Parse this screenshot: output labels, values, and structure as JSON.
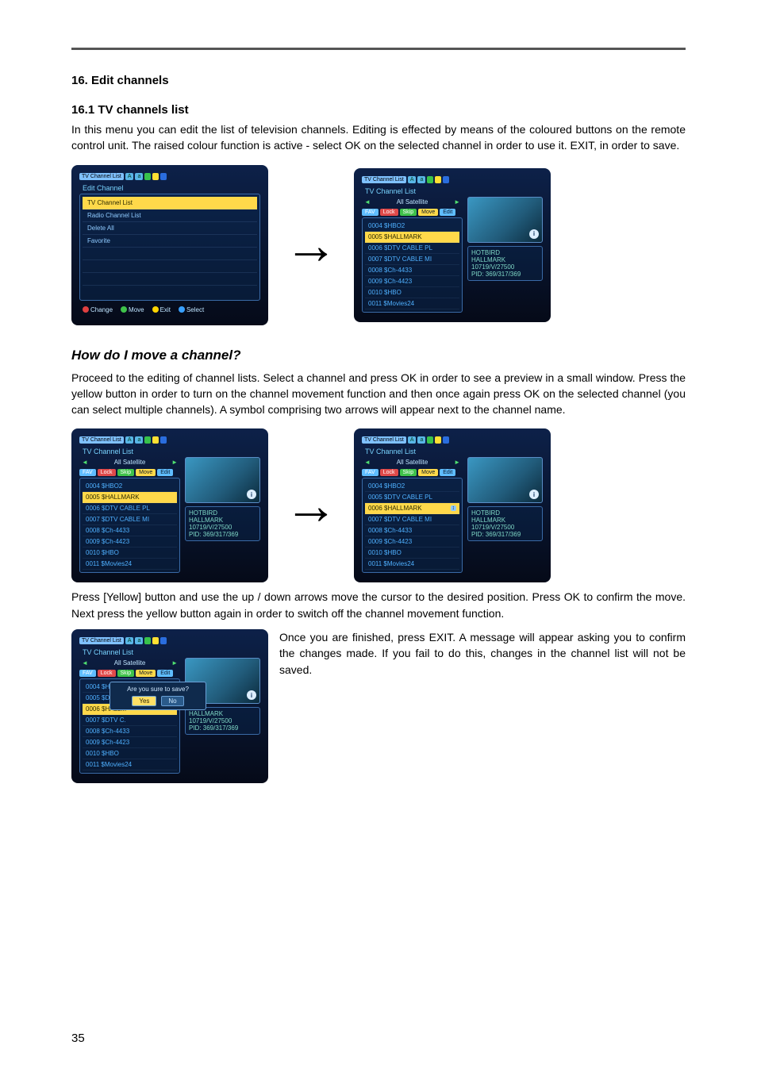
{
  "page_number": "35",
  "section": {
    "num": "16.",
    "title": "Edit channels"
  },
  "subsection": {
    "num": "16.1",
    "title": "TV channels list"
  },
  "intro_para": "In this menu you can edit the list of television channels. Editing is effected by means of the coloured buttons on the remote control unit. The raised colour function is active - select OK on the selected channel in order to use it. EXIT, in order to save.",
  "question_heading": "How do I move a channel?",
  "para_move1": "Proceed to the editing of channel lists. Select a channel and press OK in order to see a preview in a small window. Press the yellow button in order to turn on the channel movement function and then once again press OK on the selected channel (you can select multiple channels). A symbol comprising two arrows will appear next to the channel name.",
  "para_move2": "Press [Yellow] button and use the up / down arrows move the cursor to the desired position. Press OK to confirm the move. Next press the yellow button again in order to switch off the channel movement function.",
  "para_save": "Once you are finished, press EXIT. A message will appear asking you to confirm the changes made. If you fail to do this, changes in the channel list will not be saved.",
  "arrow_glyph": "→",
  "ui": {
    "tab_label": "TV Channel List",
    "tabs_icons": [
      "A",
      "a",
      "●",
      "●",
      "●"
    ],
    "edit_channel_title": "Edit Channel",
    "tv_channel_list_title": "TV Channel List",
    "menu_items": [
      "TV Channel List",
      "Radio Channel List",
      "Delete All",
      "Favorite"
    ],
    "footer": {
      "change": "Change",
      "move": "Move",
      "exit": "Exit",
      "select": "Select"
    },
    "satellite": "All Satellite",
    "fn": {
      "fav": "FAV",
      "lock": "Lock",
      "skip": "Skip",
      "move": "Move",
      "edit": "Edit"
    },
    "channels_a": [
      "0004 $HBO2",
      "0005 $HALLMARK",
      "0006 $DTV CABLE PL",
      "0007 $DTV CABLE MI",
      "0008 $Ch-4433",
      "0009 $Ch-4423",
      "0010 $HBO",
      "0011 $Movies24"
    ],
    "channels_b": [
      "0004 $HBO2",
      "0005 $DTV CABLE PL",
      "0006 $HALLMARK",
      "0007 $DTV CABLE MI",
      "0008 $Ch-4433",
      "0009 $Ch-4423",
      "0010 $HBO",
      "0011 $Movies24"
    ],
    "channels_c": [
      "0004 $HBO2",
      "0005 $DTV C.",
      "0006 $HALLM",
      "0007 $DTV C.",
      "0008 $Ch-4433",
      "0009 $Ch-4423",
      "0010 $HBO",
      "0011 $Movies24"
    ],
    "info": {
      "sat": "HOTBIRD",
      "prov": "HALLMARK",
      "tp": "10719/V/27500",
      "pid": "PID: 369/317/369"
    },
    "info_icon": "i",
    "move_icon": "↕",
    "dialog": {
      "msg": "Are you sure to save?",
      "yes": "Yes",
      "no": "No"
    }
  }
}
